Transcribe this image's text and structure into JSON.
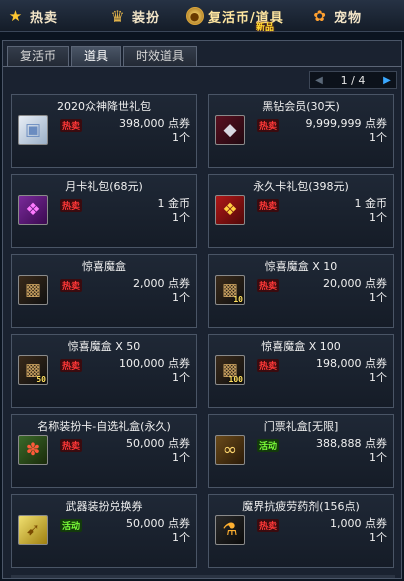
{
  "nav": [
    {
      "label": "热卖",
      "icon": "star-icon"
    },
    {
      "label": "装扮",
      "icon": "costume-icon"
    },
    {
      "label": "复活币/道具",
      "icon": "coin-icon",
      "badge": "新品"
    },
    {
      "label": "宠物",
      "icon": "pet-icon"
    }
  ],
  "tabs": [
    "复活币",
    "道具",
    "时效道具"
  ],
  "pager": {
    "text": "1 / 4"
  },
  "items": [
    {
      "name": "2020众神降世礼包",
      "badge": "热卖",
      "badge_type": "hot",
      "price": "398,000 点券",
      "qty": "1个",
      "icon": "gift-box-icon"
    },
    {
      "name": "黑钻会员(30天)",
      "badge": "热卖",
      "badge_type": "hot",
      "price": "9,999,999 点券",
      "qty": "1个",
      "icon": "black-diamond-icon"
    },
    {
      "name": "月卡礼包(68元)",
      "badge": "热卖",
      "badge_type": "hot",
      "price": "1 金币",
      "qty": "1个",
      "icon": "purple-gift-icon"
    },
    {
      "name": "永久卡礼包(398元)",
      "badge": "热卖",
      "badge_type": "hot",
      "price": "1 金币",
      "qty": "1个",
      "icon": "red-gift-icon"
    },
    {
      "name": "惊喜魔盒",
      "badge": "热卖",
      "badge_type": "hot",
      "price": "2,000 点券",
      "qty": "1个",
      "icon": "mystery-box-icon",
      "count": ""
    },
    {
      "name": "惊喜魔盒 X 10",
      "badge": "热卖",
      "badge_type": "hot",
      "price": "20,000 点券",
      "qty": "1个",
      "icon": "mystery-box-icon",
      "count": "10"
    },
    {
      "name": "惊喜魔盒 X 50",
      "badge": "热卖",
      "badge_type": "hot",
      "price": "100,000 点券",
      "qty": "1个",
      "icon": "mystery-box-icon",
      "count": "50"
    },
    {
      "name": "惊喜魔盒 X 100",
      "badge": "热卖",
      "badge_type": "hot",
      "price": "198,000 点券",
      "qty": "1个",
      "icon": "mystery-box-icon",
      "count": "100"
    },
    {
      "name": "名称装扮卡-自选礼盒(永久)",
      "badge": "热卖",
      "badge_type": "hot",
      "price": "50,000 点券",
      "qty": "1个",
      "icon": "name-card-icon"
    },
    {
      "name": "门票礼盒[无限]",
      "badge": "活动",
      "badge_type": "act",
      "price": "388,888 点券",
      "qty": "1个",
      "icon": "ticket-box-icon"
    },
    {
      "name": "武器装扮兑换券",
      "badge": "活动",
      "badge_type": "act",
      "price": "50,000 点券",
      "qty": "1个",
      "icon": "voucher-icon"
    },
    {
      "name": "魔界抗疲劳药剂(156点)",
      "badge": "热卖",
      "badge_type": "hot",
      "price": "1,000 点券",
      "qty": "1个",
      "icon": "potion-icon"
    }
  ]
}
